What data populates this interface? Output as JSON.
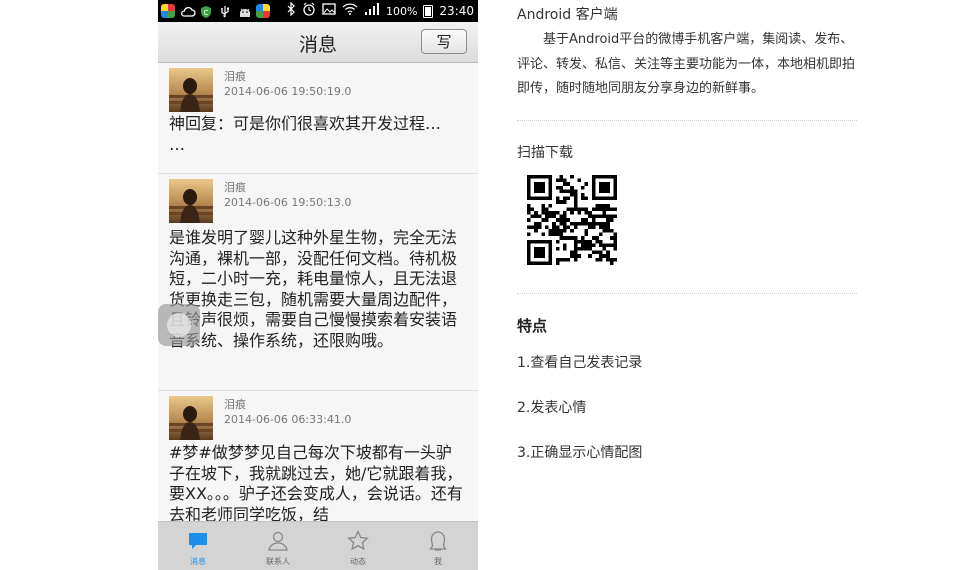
{
  "statusbar": {
    "battery": "100%",
    "time": "23:40",
    "right_icons": [
      "bluetooth-icon",
      "alarm-icon",
      "image-icon",
      "wifi-icon",
      "signal-icon"
    ],
    "left_icons": [
      "app-icon",
      "cloud-icon",
      "shield-icon",
      "usb-icon",
      "android-icon",
      "app-icon"
    ]
  },
  "header": {
    "title": "消息",
    "write_label": "写"
  },
  "posts": [
    {
      "author": "泪痕",
      "time": "2014-06-06 19:50:19.0",
      "text": "神回复：可是你们很喜欢其开发过程…\n…"
    },
    {
      "author": "泪痕",
      "time": "2014-06-06 19:50:13.0",
      "text": "是谁发明了婴儿这种外星生物，完全无法沟通，裸机一部，没配任何文档。待机极短，二小时一充，耗电量惊人，且无法退货更换走三包，随机需要大量周边配件，且铃声很烦，需要自己慢慢摸索着安装语音系统、操作系统，还限购哦。"
    },
    {
      "author": "泪痕",
      "time": "2014-06-06 06:33:41.0",
      "text": "#梦#做梦梦见自己每次下坡都有一头驴子在坡下，我就跳过去，她/它就跟着我，要XX。。。驴子还会变成人，会说话。还有去和老师同学吃饭，结"
    }
  ],
  "tabs": [
    {
      "label": "消息",
      "icon": "chat-icon",
      "active": true
    },
    {
      "label": "联系人",
      "icon": "contacts-icon",
      "active": false
    },
    {
      "label": "动态",
      "icon": "star-icon",
      "active": false
    },
    {
      "label": "我",
      "icon": "profile-icon",
      "active": false
    }
  ],
  "colors": {
    "accent": "#1f8ee8",
    "tabbar": "#d4d4d4",
    "titlebar": "#e6e6e6"
  },
  "description": {
    "app_type": "Android 客户端",
    "text": "基于Android平台的微博手机客户端，集阅读、发布、评论、转发、私信、关注等主要功能为一体，本地相机即拍即传，随时随地同朋友分享身边的新鲜事。",
    "scan_label": "扫描下载",
    "features_title": "特点",
    "features": [
      "1.查看自己发表记录",
      "2.发表心情",
      "3.正确显示心情配图"
    ]
  }
}
